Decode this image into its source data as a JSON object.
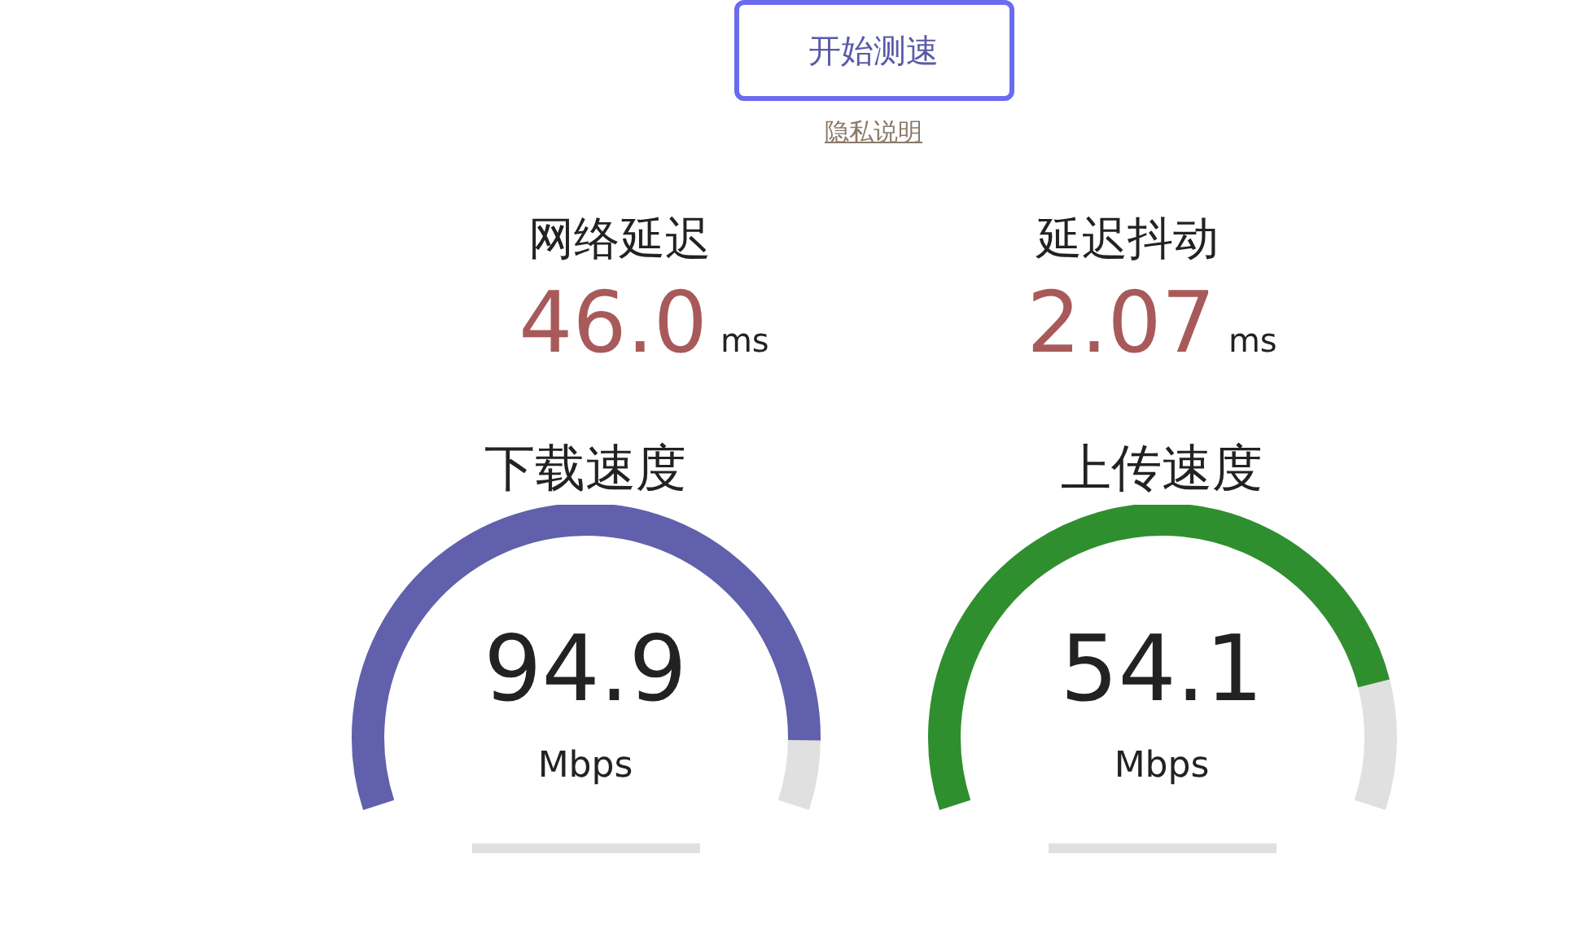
{
  "start_button": "开始测速",
  "privacy_link": "隐私说明",
  "metrics": [
    {
      "label": "网络延迟",
      "value": "46.0",
      "unit": "ms"
    },
    {
      "label": "延迟抖动",
      "value": "2.07",
      "unit": "ms"
    }
  ],
  "gauges": [
    {
      "label": "下载速度",
      "value": "94.9",
      "unit": "Mbps",
      "color": "#6060ac"
    },
    {
      "label": "上传速度",
      "value": "54.1",
      "unit": "Mbps",
      "color": "#2f8f2f"
    }
  ]
}
